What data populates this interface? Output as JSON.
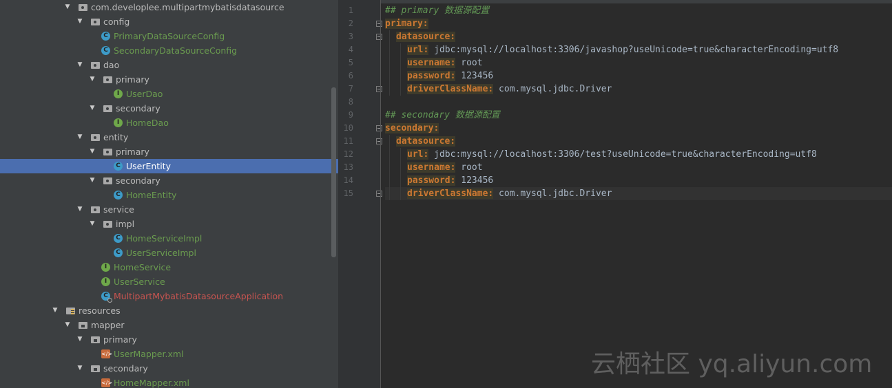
{
  "project_tree": {
    "rows": [
      {
        "label": "com.developlee.multipartmybatisdatasource",
        "kind": "package",
        "level": 0,
        "expanded": true,
        "color": "plain"
      },
      {
        "label": "config",
        "kind": "package",
        "level": 1,
        "expanded": true,
        "color": "plain"
      },
      {
        "label": "PrimaryDataSourceConfig",
        "kind": "class",
        "level": 2,
        "color": "green"
      },
      {
        "label": "SecondaryDataSourceConfig",
        "kind": "class",
        "level": 2,
        "color": "green"
      },
      {
        "label": "dao",
        "kind": "package",
        "level": 1,
        "expanded": true,
        "color": "plain"
      },
      {
        "label": "primary",
        "kind": "package",
        "level": 2,
        "expanded": true,
        "color": "plain"
      },
      {
        "label": "UserDao",
        "kind": "interface",
        "level": 3,
        "color": "green"
      },
      {
        "label": "secondary",
        "kind": "package",
        "level": 2,
        "expanded": true,
        "color": "plain"
      },
      {
        "label": "HomeDao",
        "kind": "interface",
        "level": 3,
        "color": "green"
      },
      {
        "label": "entity",
        "kind": "package",
        "level": 1,
        "expanded": true,
        "color": "plain"
      },
      {
        "label": "primary",
        "kind": "package",
        "level": 2,
        "expanded": true,
        "color": "plain"
      },
      {
        "label": "UserEntity",
        "kind": "class",
        "level": 3,
        "color": "green",
        "selected": true
      },
      {
        "label": "secondary",
        "kind": "package",
        "level": 2,
        "expanded": true,
        "color": "plain"
      },
      {
        "label": "HomeEntity",
        "kind": "class",
        "level": 3,
        "color": "green"
      },
      {
        "label": "service",
        "kind": "package",
        "level": 1,
        "expanded": true,
        "color": "plain"
      },
      {
        "label": "impl",
        "kind": "package",
        "level": 2,
        "expanded": true,
        "color": "plain"
      },
      {
        "label": "HomeServiceImpl",
        "kind": "class",
        "level": 3,
        "color": "green"
      },
      {
        "label": "UserServiceImpl",
        "kind": "class",
        "level": 3,
        "color": "green"
      },
      {
        "label": "HomeService",
        "kind": "interface",
        "level": 2,
        "color": "green"
      },
      {
        "label": "UserService",
        "kind": "interface",
        "level": 2,
        "color": "green"
      },
      {
        "label": "MultipartMybatisDatasourceApplication",
        "kind": "app",
        "level": 2,
        "color": "red"
      },
      {
        "label": "resources",
        "kind": "resources",
        "level": -1,
        "expanded": true,
        "color": "plain"
      },
      {
        "label": "mapper",
        "kind": "folder",
        "level": 0,
        "expanded": true,
        "color": "plain"
      },
      {
        "label": "primary",
        "kind": "folder",
        "level": 1,
        "expanded": true,
        "color": "plain"
      },
      {
        "label": "UserMapper.xml",
        "kind": "xml",
        "level": 2,
        "color": "green"
      },
      {
        "label": "secondary",
        "kind": "folder",
        "level": 1,
        "expanded": true,
        "color": "plain"
      },
      {
        "label": "HomeMapper.xml",
        "kind": "xml",
        "level": 2,
        "color": "green"
      }
    ]
  },
  "editor": {
    "current_line": 15,
    "lines": [
      {
        "n": "1",
        "indent": 0,
        "tokens": [
          {
            "t": "## primary 数据源配置",
            "c": "comment"
          }
        ]
      },
      {
        "n": "2",
        "indent": 0,
        "fold": true,
        "tokens": [
          {
            "t": "primary:",
            "c": "key"
          }
        ]
      },
      {
        "n": "3",
        "indent": 1,
        "fold": true,
        "tokens": [
          {
            "t": "datasource:",
            "c": "key"
          }
        ]
      },
      {
        "n": "4",
        "indent": 2,
        "tokens": [
          {
            "t": "url:",
            "c": "key"
          },
          {
            "t": " jdbc:mysql://localhost:3306/javashop?useUnicode=true&characterEncoding=utf8",
            "c": "val"
          }
        ]
      },
      {
        "n": "5",
        "indent": 2,
        "tokens": [
          {
            "t": "username:",
            "c": "key"
          },
          {
            "t": " root",
            "c": "val"
          }
        ]
      },
      {
        "n": "6",
        "indent": 2,
        "tokens": [
          {
            "t": "password:",
            "c": "key"
          },
          {
            "t": " 123456",
            "c": "val"
          }
        ]
      },
      {
        "n": "7",
        "indent": 2,
        "fold": true,
        "tokens": [
          {
            "t": "driverClassName:",
            "c": "key"
          },
          {
            "t": " com.mysql.jdbc.Driver",
            "c": "val"
          }
        ]
      },
      {
        "n": "8",
        "indent": 0,
        "tokens": []
      },
      {
        "n": "9",
        "indent": 0,
        "tokens": [
          {
            "t": "## secondary 数据源配置",
            "c": "comment"
          }
        ]
      },
      {
        "n": "10",
        "indent": 0,
        "fold": true,
        "tokens": [
          {
            "t": "secondary:",
            "c": "key"
          }
        ]
      },
      {
        "n": "11",
        "indent": 1,
        "fold": true,
        "tokens": [
          {
            "t": "datasource:",
            "c": "key"
          }
        ]
      },
      {
        "n": "12",
        "indent": 2,
        "tokens": [
          {
            "t": "url:",
            "c": "key"
          },
          {
            "t": " jdbc:mysql://localhost:3306/test?useUnicode=true&characterEncoding=utf8",
            "c": "val"
          }
        ]
      },
      {
        "n": "13",
        "indent": 2,
        "tokens": [
          {
            "t": "username:",
            "c": "key"
          },
          {
            "t": " root",
            "c": "val"
          }
        ]
      },
      {
        "n": "14",
        "indent": 2,
        "tokens": [
          {
            "t": "password:",
            "c": "key"
          },
          {
            "t": " 123456",
            "c": "val"
          }
        ]
      },
      {
        "n": "15",
        "indent": 2,
        "fold": true,
        "tokens": [
          {
            "t": "driverClassName:",
            "c": "key"
          },
          {
            "t": " com.mysql.jdbc.Driver",
            "c": "val"
          }
        ]
      }
    ]
  },
  "watermark": "云栖社区 yq.aliyun.com",
  "colors": {
    "tree_bg": "#3c3f41",
    "editor_bg": "#2b2b2b",
    "selection": "#4b6eaf",
    "key": "#cc7832",
    "comment": "#629755",
    "green_file": "#6a9b4f",
    "red_file": "#c75450"
  }
}
